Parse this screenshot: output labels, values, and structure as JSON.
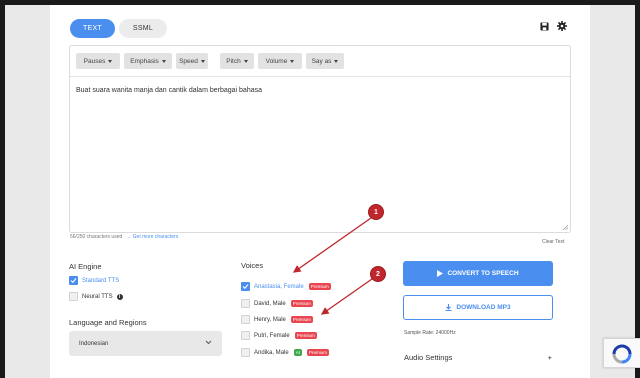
{
  "tabs": [
    {
      "label": "TEXT",
      "active": true
    },
    {
      "label": "SSML",
      "active": false
    }
  ],
  "toolbar_icons": [
    "save-icon",
    "gear-icon"
  ],
  "editor": {
    "buttons": [
      "Pauses",
      "Emphasis",
      "Speed",
      "Pitch",
      "Volume",
      "Say as"
    ],
    "text": "Buat suara wanita manja dan cantik dalam berbagai bahasa"
  },
  "counter": {
    "text": "56/250 characters used",
    "link": "→ Get more characters",
    "clear": "Clear Text"
  },
  "ai_engine": {
    "title": "AI Engine",
    "options": [
      {
        "label": "Standard TTS",
        "checked": true
      },
      {
        "label": "Neural TTS",
        "checked": false
      }
    ]
  },
  "language": {
    "title": "Language and Regions",
    "selected": "Indonesian"
  },
  "voices": {
    "title": "Voices",
    "items": [
      {
        "label": "Anastasia, Female",
        "checked": true,
        "badge_ai": "",
        "badge": "Premium"
      },
      {
        "label": "David, Male",
        "checked": false,
        "badge_ai": "",
        "badge": "Premium"
      },
      {
        "label": "Henry, Male",
        "checked": false,
        "badge_ai": "",
        "badge": "Premium"
      },
      {
        "label": "Putri, Female",
        "checked": false,
        "badge_ai": "",
        "badge": "Premium"
      },
      {
        "label": "Andika, Male",
        "checked": false,
        "badge_ai": "AI",
        "badge": "Premium"
      }
    ]
  },
  "actions": {
    "convert": "CONVERT TO SPEECH",
    "download": "DOWNLOAD MP3",
    "sample_rate": "Sample Rate: 24000Hz",
    "audio_settings": "Audio Settings",
    "audio_settings_toggle": "+"
  },
  "annotations": [
    "1",
    "2"
  ],
  "colors": {
    "accent": "#4a8ff0",
    "premium": "#e8464f",
    "ai_badge": "#3aa84e",
    "marker": "#c0262b"
  }
}
